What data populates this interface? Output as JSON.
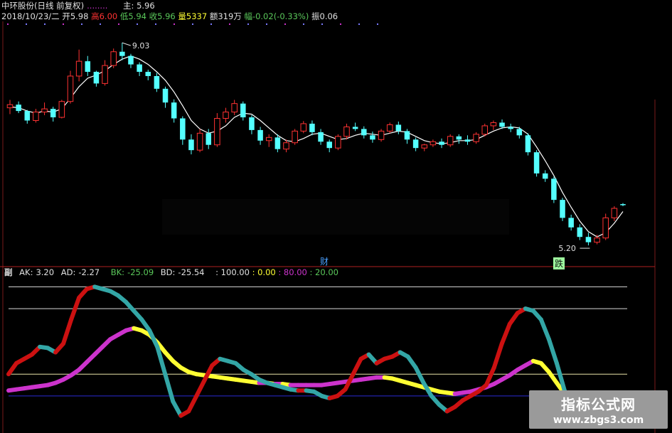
{
  "header": {
    "title": "中环股份(日线 前复权)",
    "dots": "........",
    "main_label": "主",
    "main_value": ": 5.96",
    "date": "2018/10/23/二",
    "open_label": "开",
    "open_value": "5.98",
    "high_label": "高",
    "high_value": "6.00",
    "low_label": "低",
    "low_value": "5.94",
    "close_label": "收",
    "close_value": "5.96",
    "volume_label": "量",
    "volume_value": "5337",
    "amount_label": "额",
    "amount_value": "319万",
    "change_label": "幅",
    "change_value": "-0.02(-0.33%)",
    "amplitude_label": "振",
    "amplitude_value": "0.06"
  },
  "sub_header": {
    "label": "副",
    "ak_label": "AK:",
    "ak_value": "3.20",
    "ad_label": "AD:",
    "ad_value": "-2.27",
    "bk_label": "BK:",
    "bk_value": "-25.09",
    "bd_label": "BD:",
    "bd_value": "-25.54",
    "l1": ": 100.00",
    "l2": ": 0.00",
    "l3": ": 80.00",
    "l4": ": 20.00"
  },
  "markers": {
    "cai": "财",
    "die": "跌",
    "high_label": "9.03",
    "low_label": "5.20"
  },
  "watermark": {
    "line1": "指标公式网",
    "line2": "www.zbgs3.com"
  },
  "colors": {
    "up": "#ff3232",
    "down": "#54ffff",
    "ma": "#ffffff",
    "magenta": "#cc33cc",
    "yellow": "#ffff33",
    "cyan_band": "#33a6a6",
    "red_band": "#cc1111",
    "blue": "#2a2ad4",
    "grid": "#a0a0a0",
    "orange": "#ff8c1a",
    "green": "#5ac85a"
  },
  "chart_data": [
    {
      "type": "candlestick",
      "title": "中环股份(日线 前复权)",
      "ylim": [
        5.0,
        9.3
      ],
      "max_label": 9.03,
      "min_label": 5.2,
      "ohlc": [
        [
          7.8,
          7.95,
          7.68,
          7.86
        ],
        [
          7.86,
          7.92,
          7.7,
          7.74
        ],
        [
          7.74,
          7.76,
          7.5,
          7.56
        ],
        [
          7.56,
          7.78,
          7.52,
          7.72
        ],
        [
          7.72,
          7.9,
          7.66,
          7.78
        ],
        [
          7.78,
          7.82,
          7.54,
          7.62
        ],
        [
          7.62,
          7.95,
          7.6,
          7.92
        ],
        [
          7.92,
          8.5,
          7.88,
          8.4
        ],
        [
          8.4,
          8.9,
          8.3,
          8.68
        ],
        [
          8.68,
          8.78,
          8.4,
          8.48
        ],
        [
          8.48,
          8.5,
          8.2,
          8.26
        ],
        [
          8.26,
          8.7,
          8.22,
          8.6
        ],
        [
          8.6,
          8.92,
          8.55,
          8.86
        ],
        [
          8.86,
          9.03,
          8.7,
          8.78
        ],
        [
          8.78,
          8.82,
          8.55,
          8.62
        ],
        [
          8.62,
          8.66,
          8.4,
          8.48
        ],
        [
          8.48,
          8.52,
          8.32,
          8.4
        ],
        [
          8.4,
          8.46,
          8.1,
          8.16
        ],
        [
          8.16,
          8.2,
          7.8,
          7.9
        ],
        [
          7.9,
          7.96,
          7.52,
          7.6
        ],
        [
          7.6,
          7.64,
          7.1,
          7.2
        ],
        [
          7.2,
          7.3,
          6.92,
          7.0
        ],
        [
          7.0,
          7.4,
          6.96,
          7.32
        ],
        [
          7.32,
          7.4,
          7.02,
          7.1
        ],
        [
          7.1,
          7.7,
          7.06,
          7.6
        ],
        [
          7.6,
          7.8,
          7.52,
          7.72
        ],
        [
          7.72,
          7.95,
          7.66,
          7.88
        ],
        [
          7.88,
          7.92,
          7.56,
          7.62
        ],
        [
          7.62,
          7.66,
          7.3,
          7.38
        ],
        [
          7.38,
          7.44,
          7.1,
          7.18
        ],
        [
          7.18,
          7.3,
          7.06,
          7.24
        ],
        [
          7.24,
          7.3,
          6.96,
          7.02
        ],
        [
          7.02,
          7.2,
          6.96,
          7.14
        ],
        [
          7.14,
          7.4,
          7.1,
          7.36
        ],
        [
          7.36,
          7.55,
          7.32,
          7.5
        ],
        [
          7.5,
          7.56,
          7.28,
          7.34
        ],
        [
          7.34,
          7.4,
          7.1,
          7.16
        ],
        [
          7.16,
          7.2,
          6.96,
          7.04
        ],
        [
          7.04,
          7.3,
          7.0,
          7.26
        ],
        [
          7.26,
          7.5,
          7.2,
          7.44
        ],
        [
          7.44,
          7.52,
          7.36,
          7.4
        ],
        [
          7.4,
          7.45,
          7.22,
          7.28
        ],
        [
          7.28,
          7.35,
          7.14,
          7.2
        ],
        [
          7.2,
          7.4,
          7.16,
          7.36
        ],
        [
          7.36,
          7.52,
          7.32,
          7.48
        ],
        [
          7.48,
          7.54,
          7.3,
          7.36
        ],
        [
          7.36,
          7.4,
          7.12,
          7.2
        ],
        [
          7.2,
          7.24,
          6.98,
          7.04
        ],
        [
          7.04,
          7.12,
          6.98,
          7.1
        ],
        [
          7.1,
          7.2,
          7.06,
          7.16
        ],
        [
          7.16,
          7.22,
          7.04,
          7.1
        ],
        [
          7.1,
          7.3,
          7.06,
          7.26
        ],
        [
          7.26,
          7.3,
          7.12,
          7.2
        ],
        [
          7.2,
          7.28,
          7.1,
          7.16
        ],
        [
          7.16,
          7.34,
          7.12,
          7.3
        ],
        [
          7.3,
          7.5,
          7.26,
          7.46
        ],
        [
          7.46,
          7.56,
          7.38,
          7.52
        ],
        [
          7.52,
          7.58,
          7.4,
          7.44
        ],
        [
          7.44,
          7.5,
          7.34,
          7.4
        ],
        [
          7.4,
          7.44,
          7.22,
          7.28
        ],
        [
          7.28,
          7.32,
          6.9,
          6.96
        ],
        [
          6.96,
          7.0,
          6.5,
          6.56
        ],
        [
          6.56,
          6.62,
          6.4,
          6.46
        ],
        [
          6.46,
          6.5,
          6.0,
          6.06
        ],
        [
          6.06,
          6.1,
          5.66,
          5.72
        ],
        [
          5.72,
          5.78,
          5.48,
          5.54
        ],
        [
          5.54,
          5.6,
          5.3,
          5.36
        ],
        [
          5.36,
          5.44,
          5.2,
          5.26
        ],
        [
          5.26,
          5.4,
          5.22,
          5.34
        ],
        [
          5.34,
          5.8,
          5.3,
          5.72
        ],
        [
          5.72,
          5.94,
          5.66,
          5.9
        ],
        [
          5.98,
          6.0,
          5.94,
          5.96
        ]
      ],
      "ma": [
        7.82,
        7.8,
        7.74,
        7.7,
        7.74,
        7.72,
        7.78,
        7.98,
        8.2,
        8.36,
        8.42,
        8.5,
        8.62,
        8.72,
        8.78,
        8.72,
        8.62,
        8.48,
        8.32,
        8.1,
        7.84,
        7.56,
        7.4,
        7.32,
        7.36,
        7.46,
        7.62,
        7.7,
        7.68,
        7.56,
        7.42,
        7.28,
        7.18,
        7.16,
        7.22,
        7.3,
        7.32,
        7.26,
        7.2,
        7.22,
        7.28,
        7.32,
        7.3,
        7.28,
        7.32,
        7.36,
        7.34,
        7.26,
        7.18,
        7.14,
        7.12,
        7.14,
        7.18,
        7.18,
        7.2,
        7.28,
        7.36,
        7.42,
        7.44,
        7.42,
        7.3,
        7.06,
        6.8,
        6.52,
        6.2,
        5.92,
        5.66,
        5.46,
        5.36,
        5.44,
        5.62,
        5.84
      ]
    },
    {
      "type": "line",
      "title": "副",
      "ylim": [
        -30,
        110
      ],
      "reference_lines": [
        100,
        0,
        80,
        20
      ],
      "series": [
        {
          "name": "AK",
          "color_up": "#cc1111",
          "color_down": "#33a6a6",
          "values": [
            20,
            30,
            34,
            38,
            45,
            44,
            40,
            48,
            70,
            90,
            98,
            100,
            98,
            96,
            92,
            86,
            78,
            70,
            60,
            45,
            20,
            -5,
            -18,
            -14,
            0,
            14,
            28,
            34,
            32,
            30,
            24,
            20,
            15,
            12,
            10,
            8,
            6,
            5,
            5,
            4,
            0,
            -2,
            0,
            6,
            20,
            34,
            38,
            30,
            34,
            36,
            40,
            36,
            26,
            12,
            0,
            -8,
            -14,
            -10,
            -4,
            0,
            4,
            10,
            26,
            48,
            66,
            76,
            80,
            78,
            70,
            52,
            30,
            5,
            -18,
            -26,
            -28,
            -24,
            -18,
            -10,
            -2,
            3
          ]
        },
        {
          "name": "AD",
          "color_up": "#cc33cc",
          "color_down": "#ffff33",
          "values": [
            5,
            6,
            7,
            8,
            9,
            10,
            12,
            15,
            19,
            24,
            31,
            38,
            45,
            52,
            56,
            60,
            62,
            60,
            56,
            49,
            40,
            32,
            26,
            22,
            20,
            19,
            18,
            17,
            16,
            15,
            14,
            13,
            12,
            12,
            11,
            11,
            10,
            10,
            10,
            10,
            10,
            11,
            12,
            13,
            14,
            15,
            16,
            17,
            17,
            16,
            14,
            12,
            10,
            8,
            6,
            4,
            3,
            2,
            3,
            4,
            6,
            8,
            11,
            15,
            19,
            24,
            28,
            32,
            30,
            22,
            12,
            2,
            -6,
            -12,
            -16,
            -18,
            -19,
            -20,
            -20,
            -20
          ]
        }
      ]
    }
  ]
}
